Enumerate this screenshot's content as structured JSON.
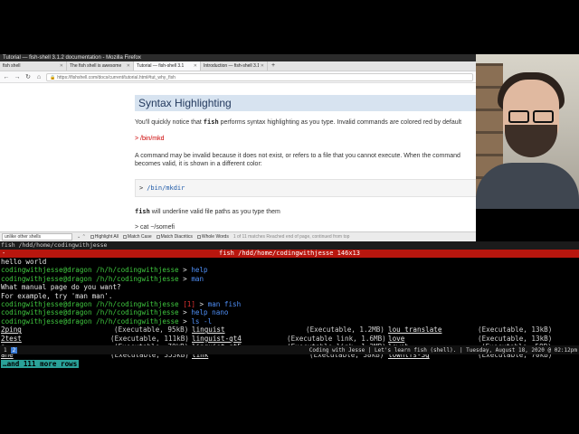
{
  "firefox": {
    "window_title": "Tutorial — fish-shell 3.1.2 documentation - Mozilla Firefox",
    "tabs": [
      {
        "label": "fish shell",
        "active": false
      },
      {
        "label": "The fish shell is awesome",
        "active": false
      },
      {
        "label": "Tutorial — fish-shell 3.1",
        "active": true
      },
      {
        "label": "Introduction — fish-shell 3.1",
        "active": false
      }
    ],
    "url": "https://fishshell.com/docs/current/tutorial.html#tut_why_fish",
    "page": {
      "heading": "Syntax Highlighting",
      "para1_pre": "You'll quickly notice that ",
      "para1_code": "fish",
      "para1_post": " performs syntax highlighting as you type. Invalid commands are colored red by default",
      "invalid_cmd": "> /bin/mkd",
      "para2": "A command may be invalid because it does not exist, or refers to a file that you cannot execute. When the command becomes valid, it is shown in a different color:",
      "code_prompt": ">",
      "code_cmd": "/bin/mkdir",
      "para3_code": "fish",
      "para3_post": " will underline valid file paths as you type them",
      "cut_line": "> cat ~/somefi"
    },
    "find_bar": {
      "query": "unlike other shells",
      "highlight_all": "Highlight All",
      "match_case": "Match Case",
      "match_diacritics": "Match Diacritics",
      "whole_words": "Whole Words",
      "status": "1 of 11 matches   Reached end of page, continued from top"
    }
  },
  "terminal": {
    "tmux_title": "fish /hdd/home/codingwithjesse",
    "title": "fish /hdd/home/codingwithjesse 146x13",
    "title_dash": "-",
    "user_host": "codingwithjesse@dragon",
    "path": "/h/h/codingwithjesse",
    "lines": {
      "l0": "hello world",
      "c1": "help",
      "c2": "man",
      "o3": "What manual page do you want?",
      "o4": "For example, try 'man man'.",
      "status5": "[1]",
      "c5": "man fish",
      "c6": "help nano",
      "c7": "ls -l"
    },
    "ls": [
      [
        {
          "name": "2ping",
          "meta": "(Executable, 95kB)"
        },
        {
          "name": "linguist",
          "meta": "(Executable, 1.2MB)"
        },
        {
          "name": "lou_translate",
          "meta": "(Executable, 13kB)"
        }
      ],
      [
        {
          "name": "2test",
          "meta": "(Executable, 111kB)"
        },
        {
          "name": "linguist-qt4",
          "meta": "(Executable link, 1.6MB)"
        },
        {
          "name": "love",
          "meta": "(Executable, 13kB)"
        }
      ],
      [
        {
          "name": "a",
          "meta": "(Executable, 70kB)"
        },
        {
          "name": "linguist-qt5",
          "meta": "(Executable link, 1.2MB)"
        },
        {
          "name": "loweb",
          "meta": "(Executable, 58B)"
        }
      ],
      [
        {
          "name": "ane",
          "meta": "(Executable, 353kB)"
        },
        {
          "name": "link",
          "meta": "(Executable, 38kB)"
        },
        {
          "name": "lowntfs-3g",
          "meta": "(Executable, 70kB)"
        }
      ]
    ],
    "more_rows": "…and 111 more rows"
  },
  "statusbar": {
    "workspaces": [
      "1",
      "2"
    ],
    "active_workspace": "2",
    "right_text": "Coding with Jesse | Let's learn fish (shell). | Tuesday, August 18, 2020 @ 02:12pm"
  },
  "colors": {
    "terminal_title_bg": "#b8160e",
    "prompt_green": "#3fc73f",
    "command_blue": "#4f8ff7",
    "error_red": "#e03232",
    "doc_heading_bg": "#d7e3f0",
    "more_rows_bg": "#2aa198"
  }
}
